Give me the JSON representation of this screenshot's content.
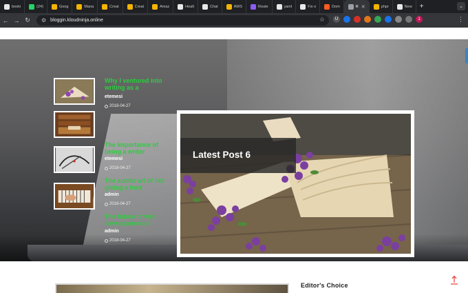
{
  "browser": {
    "tabs": [
      {
        "label": "booki",
        "color": "#e8e8e8"
      },
      {
        "label": "(24)",
        "color": "#25d366"
      },
      {
        "label": "Goog",
        "color": "#f4b400"
      },
      {
        "label": "Mana",
        "color": "#f4b400"
      },
      {
        "label": "Creat",
        "color": "#f4b400"
      },
      {
        "label": "Creat",
        "color": "#f4b400"
      },
      {
        "label": "Amaz",
        "color": "#f4b400"
      },
      {
        "label": "Healt",
        "color": "#e8e8e8"
      },
      {
        "label": "Chat",
        "color": "#e8e8e8"
      },
      {
        "label": "AWS",
        "color": "#f4b400"
      },
      {
        "label": "Route",
        "color": "#8b5cf6"
      },
      {
        "label": "yaml",
        "color": "#e8e8e8"
      },
      {
        "label": "Fix o",
        "color": "#e8e8e8"
      },
      {
        "label": "Dom",
        "color": "#ff5a1f"
      },
      {
        "label": "R",
        "color": "#9aa0a6",
        "active": true
      },
      {
        "label": "phpr",
        "color": "#f4b400"
      },
      {
        "label": "New",
        "color": "#e8e8e8"
      }
    ],
    "url": "bloggin.kloudninja.online",
    "extensions": [
      {
        "label": "U",
        "color": "#555"
      },
      {
        "label": "",
        "color": "#1a73e8"
      },
      {
        "label": "",
        "color": "#d93025"
      },
      {
        "label": "",
        "color": "#e2761b"
      },
      {
        "label": "",
        "color": "#34a853"
      },
      {
        "label": "",
        "color": "#1a73e8"
      },
      {
        "label": "",
        "color": "#888"
      },
      {
        "label": "",
        "color": "#777"
      },
      {
        "label": "1",
        "color": "#c2185b"
      }
    ]
  },
  "sidebar_posts": [
    {
      "title": "Why I ventured into writing as a",
      "author": "etemesi",
      "date": "2018-04-27"
    },
    {
      "title": "The importance of being a writer",
      "author": "etemesi",
      "date": "2018-04-27"
    },
    {
      "title": "The subtle art of not giving a fuck",
      "author": "admin",
      "date": "2018-04-27"
    },
    {
      "title": "The future of web development in",
      "author": "admin",
      "date": "2018-04-27"
    }
  ],
  "featured": {
    "title": "Latest Post 6"
  },
  "editors_choice": {
    "heading": "Editor's Choice"
  }
}
